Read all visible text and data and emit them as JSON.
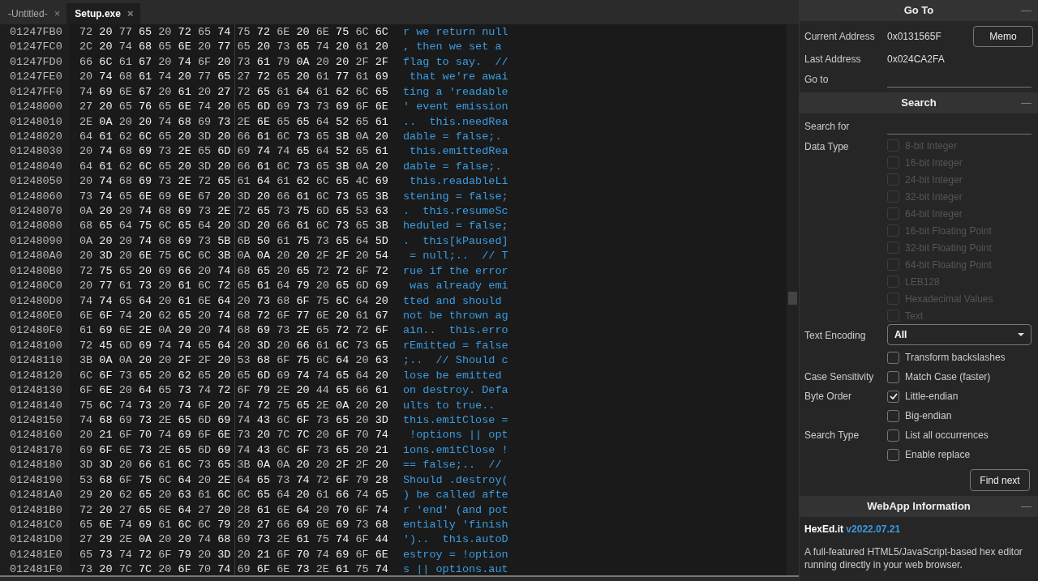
{
  "tabs": [
    {
      "label": "-Untitled-",
      "close": "×",
      "selected": false
    },
    {
      "label": "Setup.exe",
      "close": "×",
      "selected": true
    }
  ],
  "editor": {
    "rows": [
      {
        "address": "01247FB0",
        "bytes": "72 20 77 65 20 72 65 74 75 72 6E 20 6E 75 6C 6C",
        "text": "r we return null"
      },
      {
        "address": "01247FC0",
        "bytes": "2C 20 74 68 65 6E 20 77 65 20 73 65 74 20 61 20",
        "text": ", then we set a "
      },
      {
        "address": "01247FD0",
        "bytes": "66 6C 61 67 20 74 6F 20 73 61 79 0A 20 20 2F 2F",
        "text": "flag to say.  //"
      },
      {
        "address": "01247FE0",
        "bytes": "20 74 68 61 74 20 77 65 27 72 65 20 61 77 61 69",
        "text": " that we're awai"
      },
      {
        "address": "01247FF0",
        "bytes": "74 69 6E 67 20 61 20 27 72 65 61 64 61 62 6C 65",
        "text": "ting a 'readable"
      },
      {
        "address": "01248000",
        "bytes": "27 20 65 76 65 6E 74 20 65 6D 69 73 73 69 6F 6E",
        "text": "' event emission"
      },
      {
        "address": "01248010",
        "bytes": "2E 0A 20 20 74 68 69 73 2E 6E 65 65 64 52 65 61",
        "text": "..  this.needRea"
      },
      {
        "address": "01248020",
        "bytes": "64 61 62 6C 65 20 3D 20 66 61 6C 73 65 3B 0A 20",
        "text": "dable = false;. "
      },
      {
        "address": "01248030",
        "bytes": "20 74 68 69 73 2E 65 6D 69 74 74 65 64 52 65 61",
        "text": " this.emittedRea"
      },
      {
        "address": "01248040",
        "bytes": "64 61 62 6C 65 20 3D 20 66 61 6C 73 65 3B 0A 20",
        "text": "dable = false;. "
      },
      {
        "address": "01248050",
        "bytes": "20 74 68 69 73 2E 72 65 61 64 61 62 6C 65 4C 69",
        "text": " this.readableLi"
      },
      {
        "address": "01248060",
        "bytes": "73 74 65 6E 69 6E 67 20 3D 20 66 61 6C 73 65 3B",
        "text": "stening = false;"
      },
      {
        "address": "01248070",
        "bytes": "0A 20 20 74 68 69 73 2E 72 65 73 75 6D 65 53 63",
        "text": ".  this.resumeSc"
      },
      {
        "address": "01248080",
        "bytes": "68 65 64 75 6C 65 64 20 3D 20 66 61 6C 73 65 3B",
        "text": "heduled = false;"
      },
      {
        "address": "01248090",
        "bytes": "0A 20 20 74 68 69 73 5B 6B 50 61 75 73 65 64 5D",
        "text": ".  this[kPaused]"
      },
      {
        "address": "012480A0",
        "bytes": "20 3D 20 6E 75 6C 6C 3B 0A 0A 20 20 2F 2F 20 54",
        "text": " = null;..  // T"
      },
      {
        "address": "012480B0",
        "bytes": "72 75 65 20 69 66 20 74 68 65 20 65 72 72 6F 72",
        "text": "rue if the error"
      },
      {
        "address": "012480C0",
        "bytes": "20 77 61 73 20 61 6C 72 65 61 64 79 20 65 6D 69",
        "text": " was already emi"
      },
      {
        "address": "012480D0",
        "bytes": "74 74 65 64 20 61 6E 64 20 73 68 6F 75 6C 64 20",
        "text": "tted and should "
      },
      {
        "address": "012480E0",
        "bytes": "6E 6F 74 20 62 65 20 74 68 72 6F 77 6E 20 61 67",
        "text": "not be thrown ag"
      },
      {
        "address": "012480F0",
        "bytes": "61 69 6E 2E 0A 20 20 74 68 69 73 2E 65 72 72 6F",
        "text": "ain..  this.erro"
      },
      {
        "address": "01248100",
        "bytes": "72 45 6D 69 74 74 65 64 20 3D 20 66 61 6C 73 65",
        "text": "rEmitted = false"
      },
      {
        "address": "01248110",
        "bytes": "3B 0A 0A 20 20 2F 2F 20 53 68 6F 75 6C 64 20 63",
        "text": ";..  // Should c"
      },
      {
        "address": "01248120",
        "bytes": "6C 6F 73 65 20 62 65 20 65 6D 69 74 74 65 64 20",
        "text": "lose be emitted "
      },
      {
        "address": "01248130",
        "bytes": "6F 6E 20 64 65 73 74 72 6F 79 2E 20 44 65 66 61",
        "text": "on destroy. Defa"
      },
      {
        "address": "01248140",
        "bytes": "75 6C 74 73 20 74 6F 20 74 72 75 65 2E 0A 20 20",
        "text": "ults to true..  "
      },
      {
        "address": "01248150",
        "bytes": "74 68 69 73 2E 65 6D 69 74 43 6C 6F 73 65 20 3D",
        "text": "this.emitClose ="
      },
      {
        "address": "01248160",
        "bytes": "20 21 6F 70 74 69 6F 6E 73 20 7C 7C 20 6F 70 74",
        "text": " !options || opt"
      },
      {
        "address": "01248170",
        "bytes": "69 6F 6E 73 2E 65 6D 69 74 43 6C 6F 73 65 20 21",
        "text": "ions.emitClose !"
      },
      {
        "address": "01248180",
        "bytes": "3D 3D 20 66 61 6C 73 65 3B 0A 0A 20 20 2F 2F 20",
        "text": "== false;..  // "
      },
      {
        "address": "01248190",
        "bytes": "53 68 6F 75 6C 64 20 2E 64 65 73 74 72 6F 79 28",
        "text": "Should .destroy("
      },
      {
        "address": "012481A0",
        "bytes": "29 20 62 65 20 63 61 6C 6C 65 64 20 61 66 74 65",
        "text": ") be called afte"
      },
      {
        "address": "012481B0",
        "bytes": "72 20 27 65 6E 64 27 20 28 61 6E 64 20 70 6F 74",
        "text": "r 'end' (and pot"
      },
      {
        "address": "012481C0",
        "bytes": "65 6E 74 69 61 6C 6C 79 20 27 66 69 6E 69 73 68",
        "text": "entially 'finish"
      },
      {
        "address": "012481D0",
        "bytes": "27 29 2E 0A 20 20 74 68 69 73 2E 61 75 74 6F 44",
        "text": "')..  this.autoD"
      },
      {
        "address": "012481E0",
        "bytes": "65 73 74 72 6F 79 20 3D 20 21 6F 70 74 69 6F 6E",
        "text": "estroy = !option"
      },
      {
        "address": "012481F0",
        "bytes": "73 20 7C 7C 20 6F 70 74 69 6F 6E 73 2E 61 75 74",
        "text": "s || options.aut"
      }
    ]
  },
  "goto": {
    "title": "Go To",
    "collapse": "—",
    "current_label": "Current Address",
    "current_value": "0x0131565F",
    "memo_button": "Memo",
    "last_label": "Last Address",
    "last_value": "0x024CA2FA",
    "goto_label": "Go to"
  },
  "search": {
    "title": "Search",
    "collapse": "—",
    "search_for_label": "Search for",
    "groups": [
      {
        "label": "Data Type",
        "options": [
          {
            "label": "8-bit Integer",
            "checked": false,
            "disabled": true
          },
          {
            "label": "16-bit Integer",
            "checked": false,
            "disabled": true
          },
          {
            "label": "24-bit Integer",
            "checked": false,
            "disabled": true
          },
          {
            "label": "32-bit Integer",
            "checked": false,
            "disabled": true
          },
          {
            "label": "64-bit Integer",
            "checked": false,
            "disabled": true
          },
          {
            "label": "16-bit Floating Point",
            "checked": false,
            "disabled": true
          },
          {
            "label": "32-bit Floating Point",
            "checked": false,
            "disabled": true
          },
          {
            "label": "64-bit Floating Point",
            "checked": false,
            "disabled": true
          },
          {
            "label": "LEB128",
            "checked": false,
            "disabled": true
          },
          {
            "label": "Hexadecimal Values",
            "checked": false,
            "disabled": true
          },
          {
            "label": "Text",
            "checked": false,
            "disabled": true
          }
        ]
      },
      {
        "label": "Text Encoding",
        "select": "All",
        "options": [
          {
            "label": "Transform backslashes",
            "checked": false,
            "disabled": false
          }
        ]
      },
      {
        "label": "Case Sensitivity",
        "options": [
          {
            "label": "Match Case (faster)",
            "checked": false,
            "disabled": false
          }
        ]
      },
      {
        "label": "Byte Order",
        "options": [
          {
            "label": "Little-endian",
            "checked": true,
            "disabled": false
          },
          {
            "label": "Big-endian",
            "checked": false,
            "disabled": false
          }
        ]
      },
      {
        "label": "Search Type",
        "options": [
          {
            "label": "List all occurrences",
            "checked": false,
            "disabled": false
          },
          {
            "label": "Enable replace",
            "checked": false,
            "disabled": false
          }
        ]
      }
    ],
    "find_button": "Find next"
  },
  "info": {
    "title": "WebApp Information",
    "collapse": "—",
    "app_name": "HexEd.it",
    "version": "v2022.07.21",
    "description": "A full-featured HTML5/JavaScript-based hex editor running directly in your web browser."
  }
}
